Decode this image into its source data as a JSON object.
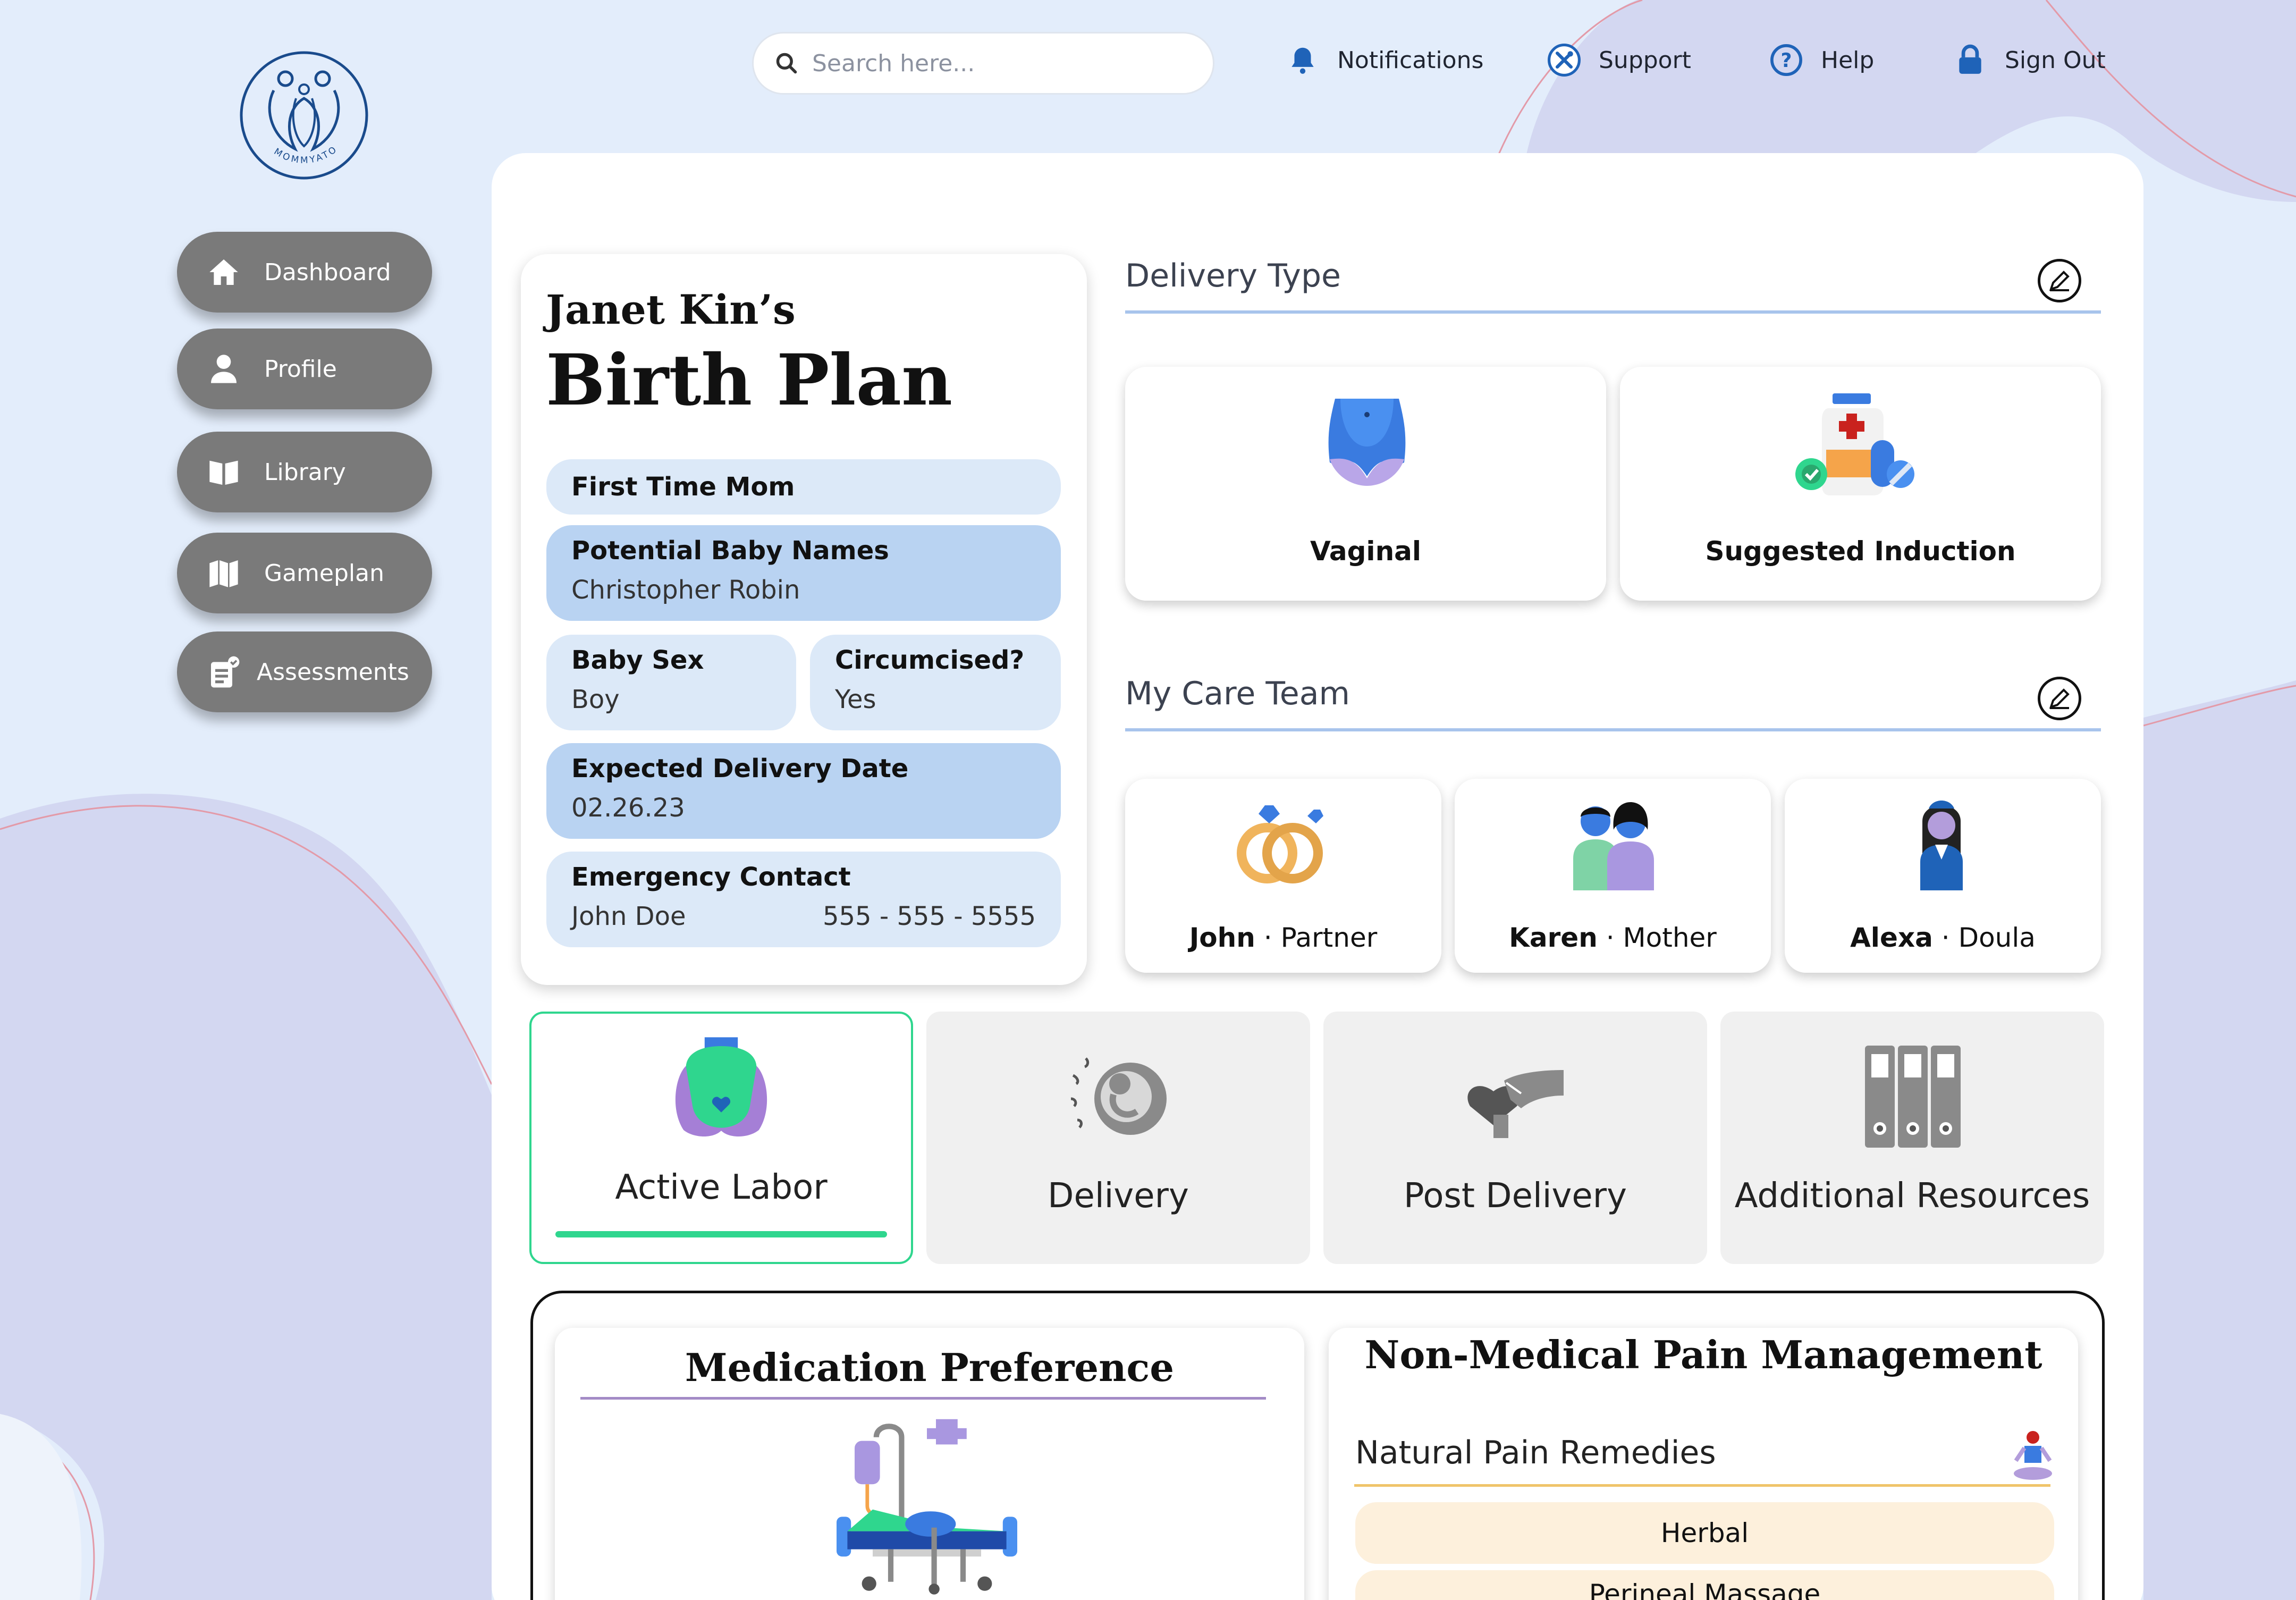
{
  "brand": {
    "logo_text": "MOMMYATO"
  },
  "search": {
    "placeholder": "Search here..."
  },
  "topnav": {
    "notifications": "Notifications",
    "support": "Support",
    "help": "Help",
    "signout": "Sign Out"
  },
  "sidebar": {
    "items": [
      {
        "label": "Dashboard",
        "icon": "home-icon"
      },
      {
        "label": "Profile",
        "icon": "user-icon"
      },
      {
        "label": "Library",
        "icon": "book-icon"
      },
      {
        "label": "Gameplan",
        "icon": "map-icon"
      },
      {
        "label": "Assessments",
        "icon": "clipboard-check-icon"
      }
    ]
  },
  "plan": {
    "owner": "Janet Kin’s",
    "title": "Birth Plan",
    "first_time": "First Time Mom",
    "baby_names_label": "Potential Baby Names",
    "baby_names_value": "Christopher Robin",
    "baby_sex_label": "Baby Sex",
    "baby_sex_value": "Boy",
    "circumcised_label": "Circumcised?",
    "circumcised_value": "Yes",
    "edd_label": "Expected Delivery Date",
    "edd_value": "02.26.23",
    "emergency_label": "Emergency Contact",
    "emergency_name": "John Doe",
    "emergency_phone": "555 - 555 - 5555"
  },
  "delivery_type": {
    "title": "Delivery Type",
    "options": [
      {
        "label": "Vaginal"
      },
      {
        "label": "Suggested Induction"
      }
    ]
  },
  "care_team": {
    "title": "My Care Team",
    "members": [
      {
        "name": "John",
        "role": "Partner"
      },
      {
        "name": "Karen",
        "role": "Mother"
      },
      {
        "name": "Alexa",
        "role": "Doula"
      }
    ],
    "separator": "·"
  },
  "stages": [
    {
      "label": "Active Labor",
      "active": true
    },
    {
      "label": "Delivery",
      "active": false
    },
    {
      "label": "Post Delivery",
      "active": false
    },
    {
      "label": "Additional Resources",
      "active": false
    }
  ],
  "medication": {
    "title": "Medication Preference"
  },
  "pain": {
    "title": "Non-Medical Pain Management",
    "remedies_title": "Natural Pain Remedies",
    "remedies": [
      "Herbal",
      "Perineal Massage"
    ]
  },
  "colors": {
    "accent_green": "#2fd68e",
    "pill_light": "#dce9f8",
    "pill_mid": "#b9d3f2",
    "sidebar_gray": "#7a7a7a",
    "brand_blue": "#1a4b8c",
    "remedy_bg": "#fdf0dc"
  }
}
